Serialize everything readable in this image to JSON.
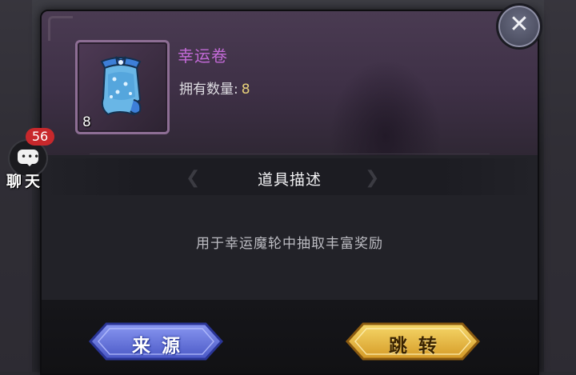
{
  "item": {
    "name": "幸运卷",
    "count_badge": "8",
    "quantity_label": "拥有数量:",
    "quantity_value": "8",
    "name_color": "#c36ad7",
    "icon": "lucky-scroll-icon"
  },
  "description": {
    "title": "道具描述",
    "text": "用于幸运魔轮中抽取丰富奖励"
  },
  "buttons": {
    "source_label": "来源",
    "jump_label": "跳转",
    "source_color": "#5b6bd6",
    "jump_color": "#e2b53e"
  },
  "close": {
    "icon": "close-icon"
  },
  "chat": {
    "badge": "56",
    "label": "聊天",
    "icon": "chat-bubble-icon"
  }
}
